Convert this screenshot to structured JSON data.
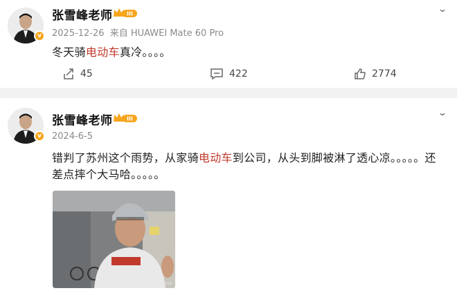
{
  "posts": [
    {
      "username": "张雪峰老师",
      "badge_level": "III",
      "verified_icon": "v",
      "date": "2025-12-26",
      "source": "来自 HUAWEI Mate 60 Pro",
      "content_parts": [
        "冬天骑",
        "电动车",
        "真冷。。。。"
      ],
      "actions": {
        "repost": "45",
        "comment": "422",
        "like": "2774"
      },
      "menu_icon": "chevron-down-icon"
    },
    {
      "username": "张雪峰老师",
      "badge_level": "III",
      "verified_icon": "v",
      "date": "2024-6-5",
      "content_line1_parts": [
        "错判了苏州这个雨势，从家骑",
        "电动车",
        "到公司，从头到脚被淋了透心凉。。。。。还"
      ],
      "content_line2": "差点摔个大马哈。。。。。",
      "photo_watermark": "抖音号：xxxx",
      "menu_icon": "chevron-down-icon"
    }
  ],
  "colors": {
    "highlight": "#c0392b",
    "badge": "#f7a51c",
    "background": "#f2f2f2"
  }
}
